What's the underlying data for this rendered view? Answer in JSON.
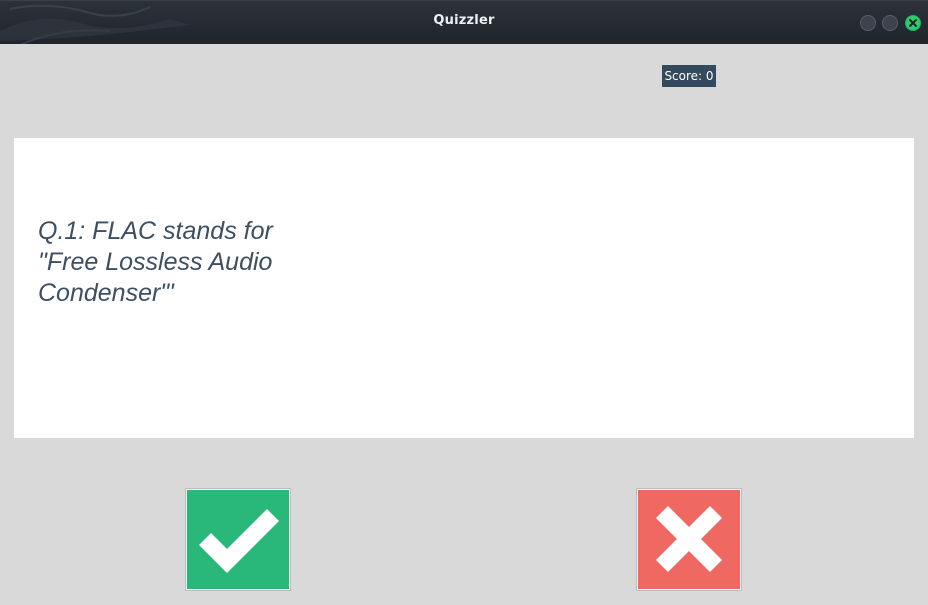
{
  "window": {
    "title": "Quizzler"
  },
  "score": {
    "label": "Score: 0"
  },
  "question": {
    "text": "Q.1: FLAC stands for \"Free Lossless Audio Condenser\"'"
  },
  "answers": {
    "true_icon": "check-icon",
    "false_icon": "cross-icon"
  },
  "colors": {
    "titlebar": "#20252c",
    "background": "#d9d9d9",
    "score_bg": "#364a5d",
    "question_text": "#3d4f61",
    "true_button": "#2ab87a",
    "false_button": "#ef6862"
  }
}
